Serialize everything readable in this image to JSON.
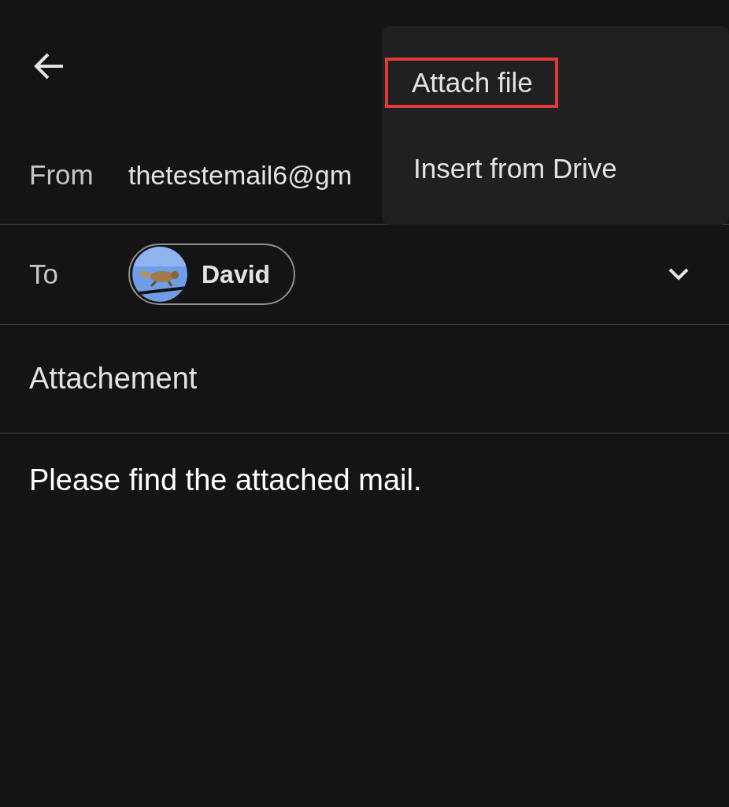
{
  "compose": {
    "from_label": "From",
    "from_value": "thetestemail6@gm",
    "to_label": "To",
    "recipients": [
      {
        "name": "David"
      }
    ],
    "subject": "Attachement",
    "body": "Please find the attached mail."
  },
  "menu": {
    "items": [
      {
        "label": "Attach file",
        "highlighted": true
      },
      {
        "label": "Insert from Drive",
        "highlighted": false
      }
    ]
  }
}
